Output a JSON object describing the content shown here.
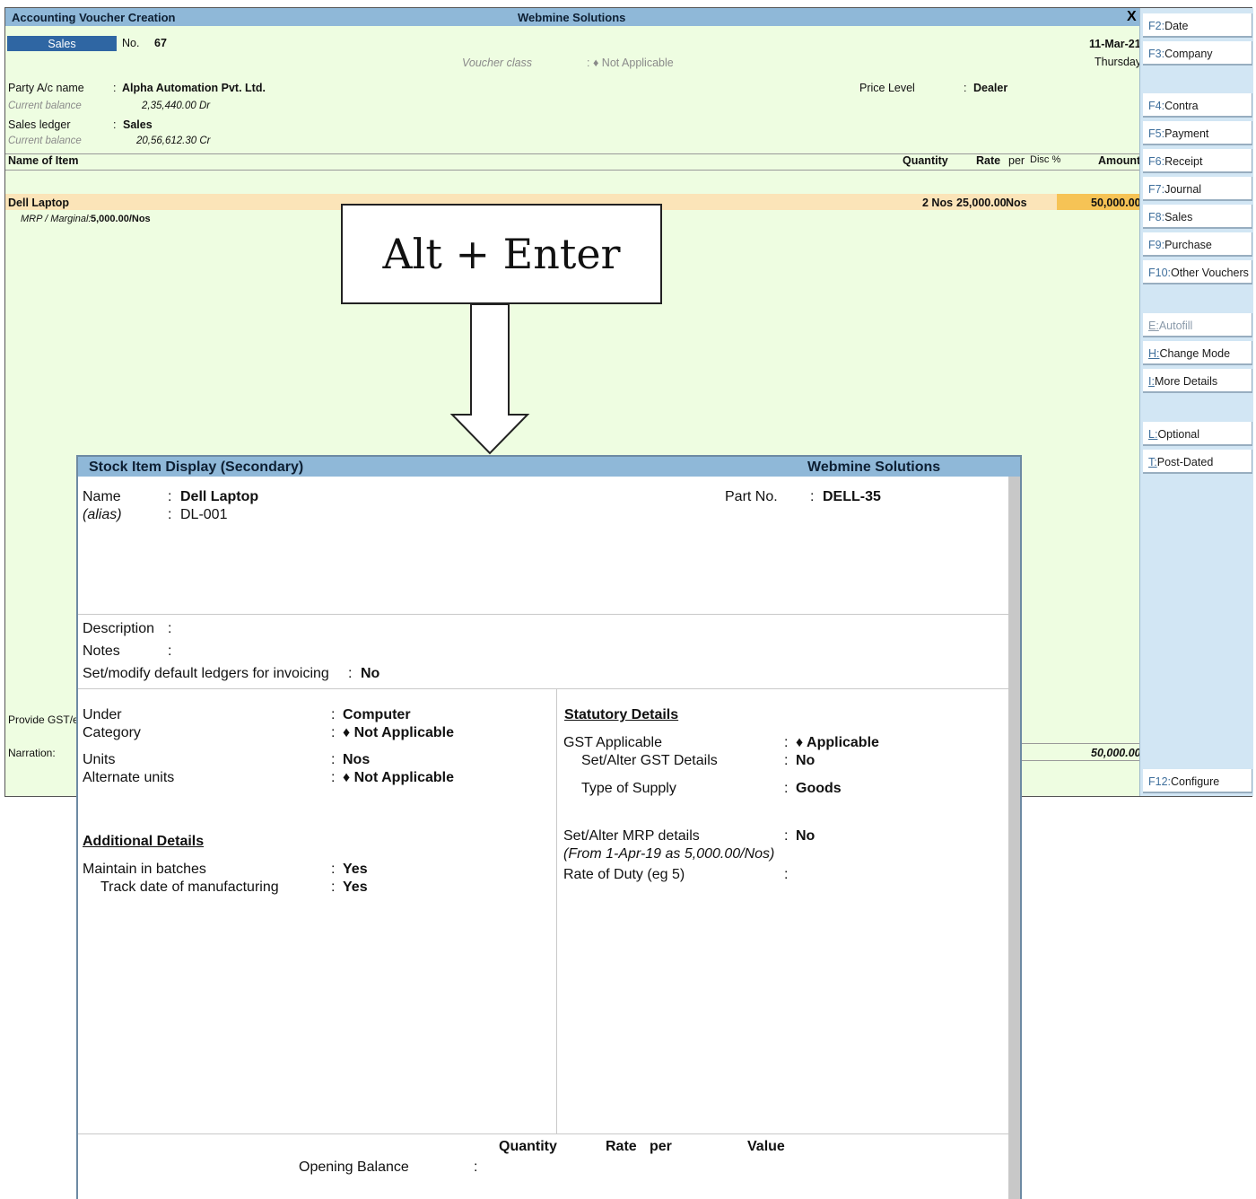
{
  "voucher": {
    "window_title": "Accounting Voucher Creation",
    "company": "Webmine Solutions",
    "close": "X",
    "voucher_type": "Sales",
    "no_label": "No.",
    "no_value": "67",
    "date": "11-Mar-21",
    "day": "Thursday",
    "voucher_class_label": "Voucher class",
    "voucher_class_value": ": ♦ Not Applicable",
    "party_label": "Party A/c name",
    "party_value": "Alpha Automation Pvt. Ltd.",
    "party_balance_label": "Current balance",
    "party_balance_value": "2,35,440.00 Dr",
    "sales_ledger_label": "Sales ledger",
    "sales_ledger_value": "Sales",
    "sales_balance_label": "Current balance",
    "sales_balance_value": "20,56,612.30 Cr",
    "price_level_label": "Price Level",
    "price_level_value": "Dealer",
    "columns": {
      "name": "Name of Item",
      "quantity": "Quantity",
      "rate": "Rate",
      "per": "per",
      "disc": "Disc %",
      "amount": "Amount"
    },
    "item": {
      "name": "Dell Laptop",
      "quantity": "2 Nos",
      "rate": "25,000.00",
      "per": "Nos",
      "amount": "50,000.00",
      "mrp_label": "MRP / Marginal:",
      "mrp_value": "5,000.00/Nos"
    },
    "provide_gst_label": "Provide GST/e-",
    "narration_label": "Narration:",
    "total": "50,000.00"
  },
  "side_buttons": [
    {
      "key": "F2:",
      "label": "Date"
    },
    {
      "key": "F3:",
      "label": "Company"
    },
    {
      "key": "F4:",
      "label": "Contra"
    },
    {
      "key": "F5:",
      "label": "Payment"
    },
    {
      "key": "F6:",
      "label": "Receipt"
    },
    {
      "key": "F7:",
      "label": "Journal"
    },
    {
      "key": "F8:",
      "label": "Sales"
    },
    {
      "key": "F9:",
      "label": "Purchase"
    },
    {
      "key": "F10:",
      "label": "Other Vouchers"
    },
    {
      "key": "E:",
      "label": "Autofill"
    },
    {
      "key": "H:",
      "label": "Change Mode"
    },
    {
      "key": "I:",
      "label": "More Details"
    },
    {
      "key": "L:",
      "label": "Optional"
    },
    {
      "key": "T:",
      "label": "Post-Dated"
    },
    {
      "key": "F12:",
      "label": "Configure"
    }
  ],
  "callout": {
    "text": "Alt + Enter"
  },
  "stock": {
    "title": "Stock Item Display (Secondary)",
    "company": "Webmine Solutions",
    "name_label": "Name",
    "name_value": "Dell Laptop",
    "alias_label": "(alias)",
    "alias_value": "DL-001",
    "part_no_label": "Part No.",
    "part_no_value": "DELL-35",
    "description_label": "Description",
    "notes_label": "Notes",
    "set_modify_label": "Set/modify default ledgers for invoicing",
    "set_modify_value": "No",
    "under_label": "Under",
    "under_value": "Computer",
    "category_label": "Category",
    "category_value": "♦ Not Applicable",
    "units_label": "Units",
    "units_value": "Nos",
    "alt_units_label": "Alternate units",
    "alt_units_value": "♦ Not Applicable",
    "additional_heading": "Additional Details",
    "batches_label": "Maintain in batches",
    "batches_value": "Yes",
    "track_date_label": "Track date of manufacturing",
    "track_date_value": "Yes",
    "statutory_heading": "Statutory Details",
    "gst_label": "GST Applicable",
    "gst_value": "♦ Applicable",
    "gst_details_label": "Set/Alter GST Details",
    "gst_details_value": "No",
    "supply_label": "Type of Supply",
    "supply_value": "Goods",
    "mrp_label": "Set/Alter MRP details",
    "mrp_value": "No",
    "mrp_note": "(From 1-Apr-19 as 5,000.00/Nos)",
    "duty_label": "Rate of Duty (eg 5)",
    "footer_quantity": "Quantity",
    "footer_rate": "Rate",
    "footer_per": "per",
    "footer_value": "Value",
    "opening_balance_label": "Opening Balance"
  }
}
